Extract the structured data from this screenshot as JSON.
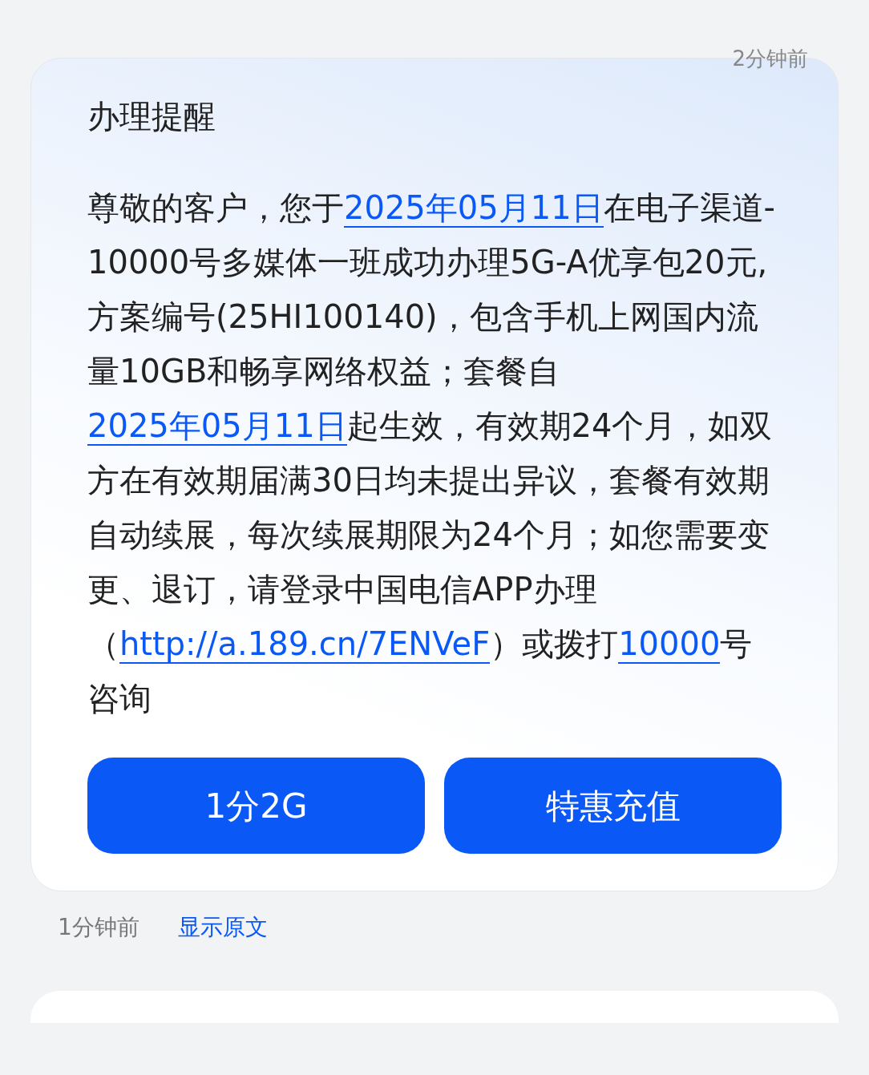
{
  "previous_time": "2分钟前",
  "message": {
    "title": "办理提醒",
    "segments": [
      {
        "kind": "text",
        "text": "尊敬的客户，您于"
      },
      {
        "kind": "link",
        "text": "2025年05月11日"
      },
      {
        "kind": "text",
        "text": "在电子渠道-10000号多媒体一班成功办理5G-A优享包20元,方案编号(25HI100140)，包含手机上网国内流量10GB和畅享网络权益；套餐自"
      },
      {
        "kind": "link",
        "text": "2025年05月11日"
      },
      {
        "kind": "text",
        "text": "起生效，有效期24个月，如双方在有效期届满30日均未提出异议，套餐有效期自动续展，每次续展期限为24个月；如您需要变更、退订，请登录中国电信APP办理（"
      },
      {
        "kind": "link",
        "text": "http://a.189.cn/7ENVeF"
      },
      {
        "kind": "text",
        "text": "）或拨打"
      },
      {
        "kind": "link",
        "text": "10000"
      },
      {
        "kind": "text",
        "text": "号咨询"
      }
    ],
    "buttons": [
      "1分2G",
      "特惠充值"
    ]
  },
  "time": "1分钟前",
  "show_original": "显示原文"
}
